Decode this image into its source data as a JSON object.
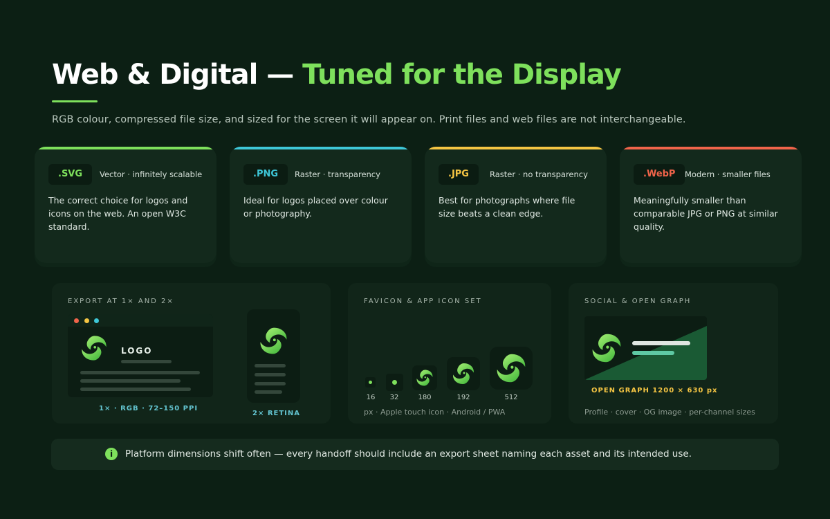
{
  "header": {
    "title_part1": "Web & Digital —",
    "title_part2": "Tuned for the Display",
    "subtitle": "RGB colour, compressed file size, and sized for the screen it will appear on. Print files and web files are not interchangeable."
  },
  "formats": [
    {
      "ext": ".SVG",
      "desc": "Vector · infinitely scalable",
      "body": "The correct choice for logos and icons on the web. An open W3C standard.",
      "accent": "#7ee05c"
    },
    {
      "ext": ".PNG",
      "desc": "Raster · transparency",
      "body": "Ideal for logos placed over colour or photography.",
      "accent": "#3ec7d8"
    },
    {
      "ext": ".JPG",
      "desc": "Raster · no transparency",
      "body": "Best for photographs where file size beats a clean edge.",
      "accent": "#f5c543"
    },
    {
      "ext": ".WebP",
      "desc": "Modern · smaller files",
      "body": "Meaningfully smaller than comparable JPG or PNG at similar quality.",
      "accent": "#f0644a"
    }
  ],
  "export_panel": {
    "label": "EXPORT AT 1× AND 2×",
    "logo_text": "LOGO",
    "desktop_caption": "1× · RGB · 72–150 PPI",
    "retina_caption": "2× RETINA"
  },
  "favicon_panel": {
    "label": "FAVICON & APP ICON SET",
    "sizes": [
      "16",
      "32",
      "180",
      "192",
      "512"
    ],
    "caption": "px · Apple touch icon · Android / PWA"
  },
  "social_panel": {
    "label": "SOCIAL & OPEN GRAPH",
    "og_caption": "OPEN GRAPH 1200 × 630 px",
    "caption": "Profile · cover · OG image · per-channel sizes"
  },
  "info_bar": {
    "icon": "i",
    "text": "Platform dimensions shift often — every handoff should include an export sheet naming each asset and its intended use."
  },
  "colors": {
    "background": "#0c1f14",
    "brand_green": "#7ee05c",
    "accent_cyan": "#3ec7d8",
    "accent_yellow": "#f5c543",
    "accent_red": "#f0644a"
  }
}
